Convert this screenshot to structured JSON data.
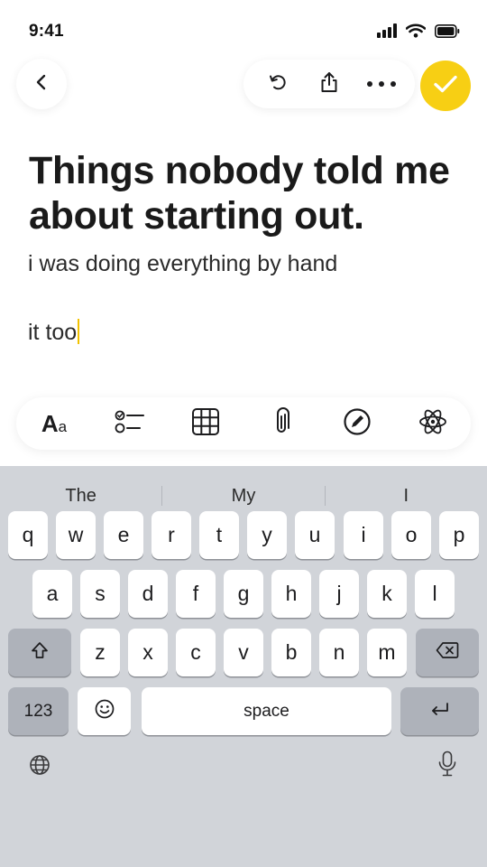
{
  "status_bar": {
    "time": "9:41"
  },
  "header": {
    "back_icon": "chevron-left-icon",
    "actions": [
      "undo-icon",
      "share-icon",
      "more-icon"
    ],
    "done_icon": "check-icon",
    "accent_color": "#f7cf14"
  },
  "note": {
    "title": "Things nobody told me about starting out.",
    "lines": [
      "i was doing everything by hand",
      "it too"
    ]
  },
  "format_toolbar": {
    "text_style_big": "A",
    "text_style_small": "a",
    "tools": [
      "text-style-icon",
      "checklist-icon",
      "table-icon",
      "attachment-icon",
      "draw-icon",
      "ai-icon"
    ]
  },
  "keyboard": {
    "suggestions": [
      "The",
      "My",
      "I"
    ],
    "row1": [
      "q",
      "w",
      "e",
      "r",
      "t",
      "y",
      "u",
      "i",
      "o",
      "p"
    ],
    "row2": [
      "a",
      "s",
      "d",
      "f",
      "g",
      "h",
      "j",
      "k",
      "l"
    ],
    "row3": [
      "z",
      "x",
      "c",
      "v",
      "b",
      "n",
      "m"
    ],
    "numbers_label": "123",
    "space_label": "space"
  }
}
